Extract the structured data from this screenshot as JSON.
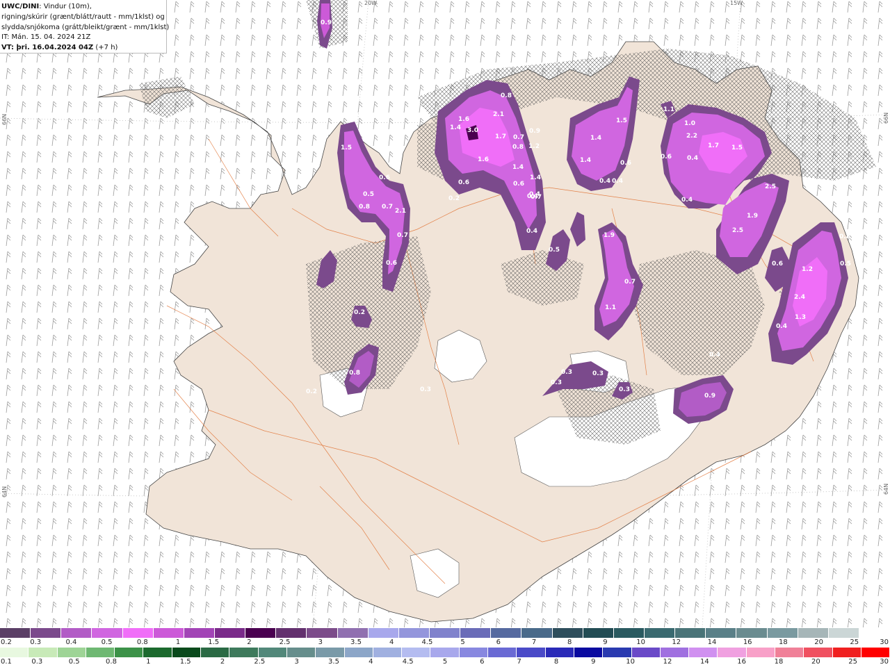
{
  "info": {
    "title_bold": "UWC/DINI",
    "title_rest": ": Vindur (10m),",
    "line2": "rigning/skúrir (grænt/blátt/rautt - mm/1klst) og",
    "line3": "slydda/snjókoma (grátt/bleikt/grænt - mm/1klst)",
    "line4": "IT: Mán. 15. 04. 2024 21Z",
    "line5_bold": "VT: þri. 16.04.2024 04Z",
    "line5_rest": " (+7 h)"
  },
  "grid_labels": {
    "lon_20w": "20W",
    "lon_15w": "15W",
    "lat_66n_left": "66N",
    "lat_66n_right": "66N",
    "lat_64n_left": "64N",
    "lat_64n_right": "64N"
  },
  "precip_values": [
    "0.9",
    "0.8",
    "1.6",
    "1.4",
    "3.0",
    "2.1",
    "0.9",
    "0.7",
    "1.7",
    "0.8",
    "1.2",
    "1.6",
    "1.4",
    "1.4",
    "0.6",
    "1.5",
    "1.4",
    "1.4",
    "0.6",
    "0.4",
    "0.4",
    "1.1",
    "1.0",
    "2.2",
    "1.7",
    "1.5",
    "0.4",
    "0.6",
    "1.5",
    "0.6",
    "0.5",
    "0.7",
    "0.8",
    "2.1",
    "0.7",
    "0.6",
    "0.2",
    "0.6",
    "0.4",
    "0.4",
    "0.7",
    "0.4",
    "0.5",
    "1.9",
    "0.7",
    "1.1",
    "2.5",
    "1.9",
    "2.5",
    "0.4",
    "0.6",
    "1.2",
    "2.4",
    "1.3",
    "0.4",
    "0.8",
    "0.5",
    "0.2",
    "0.8",
    "0.3",
    "0.3",
    "0.3",
    "0.3",
    "0.4",
    "0.9",
    "0.3",
    "0.2"
  ],
  "snow_scale": {
    "colors": [
      "#5b3f66",
      "#7b4a8c",
      "#b25cc6",
      "#d066e0",
      "#f06ef8",
      "#cc5ad8",
      "#a244b6",
      "#7a2a8a",
      "#4a0050",
      "#63306e",
      "#7c4c8a",
      "#9070b0",
      "#a8a8ec",
      "#9496dc",
      "#8082cc",
      "#6a6cb8",
      "#566aa0",
      "#4a6a8a",
      "#2e4e5c",
      "#224c54",
      "#2a5a60",
      "#3a6a70",
      "#4a7478",
      "#5a8088",
      "#6a8c90",
      "#7a9aa0",
      "#a6b6b8",
      "#cbd6d6",
      "#ffffff"
    ],
    "labels": [
      "0.2",
      "0.3",
      "0.4",
      "0.5",
      "0.8",
      "1",
      "1.5",
      "2",
      "2.5",
      "3",
      "3.5",
      "4",
      "4.5",
      "5",
      "6",
      "7",
      "8",
      "9",
      "10",
      "12",
      "14",
      "16",
      "18",
      "20",
      "25",
      "30"
    ]
  },
  "rain_scale": {
    "colors": [
      "#e8f8e0",
      "#c8eab8",
      "#9ed496",
      "#6eb872",
      "#3c9248",
      "#1c6a2e",
      "#0a4a1c",
      "#2a6a44",
      "#3e7a5c",
      "#52887a",
      "#668e8c",
      "#7a9aa8",
      "#8ca6c8",
      "#a0b0e0",
      "#b4bcf0",
      "#a8a8ec",
      "#8888e0",
      "#6a6ad4",
      "#4a4ac8",
      "#2a2ab8",
      "#0a0aa0",
      "#2a3ab0",
      "#6a4ac8",
      "#a070e0",
      "#d090f0",
      "#f0a0e0",
      "#f8a0c8",
      "#f08098",
      "#f05060",
      "#f02020",
      "#ff0000"
    ],
    "labels": [
      "0.1",
      "0.3",
      "0.5",
      "0.8",
      "1",
      "1.5",
      "2",
      "2.5",
      "3",
      "3.5",
      "4",
      "4.5",
      "5",
      "6",
      "7",
      "8",
      "9",
      "10",
      "12",
      "14",
      "16",
      "18",
      "20",
      "25",
      "30"
    ]
  }
}
